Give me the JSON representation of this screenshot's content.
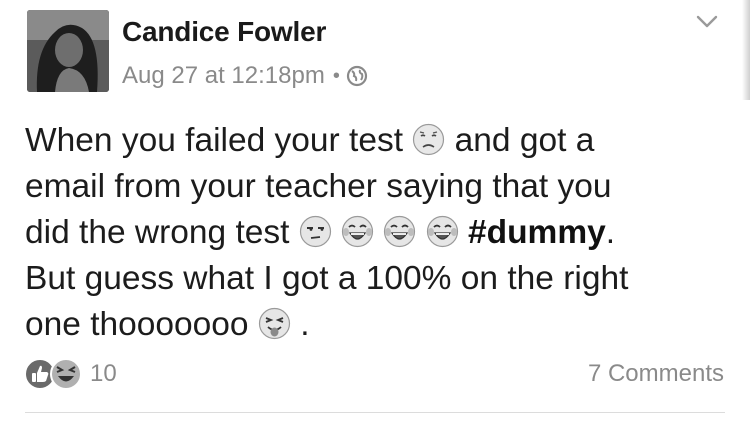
{
  "post": {
    "author": "Candice Fowler",
    "date": "Aug 27 at 12:18pm",
    "separator": "•",
    "privacy_icon": "globe-icon",
    "menu_icon": "chevron-down-icon",
    "body": {
      "line1_a": "When you failed your test",
      "line1_b": "and got a",
      "line2": "email from your teacher saying that you",
      "line3_a": "did the wrong test",
      "hashtag": "#dummy",
      "line3_end": ".",
      "line4": "But guess what I got a 100% on the right",
      "line5_a": "one thooooooo",
      "line5_end": "."
    },
    "emojis": {
      "sad": "sad-face-emoji",
      "unamused": "unamused-face-emoji",
      "crying_laughing": "tears-of-joy-emoji",
      "tongue": "winking-tongue-face-emoji"
    },
    "reactions": {
      "types": [
        "like",
        "haha"
      ],
      "count": "10"
    },
    "comments": "7 Comments"
  }
}
